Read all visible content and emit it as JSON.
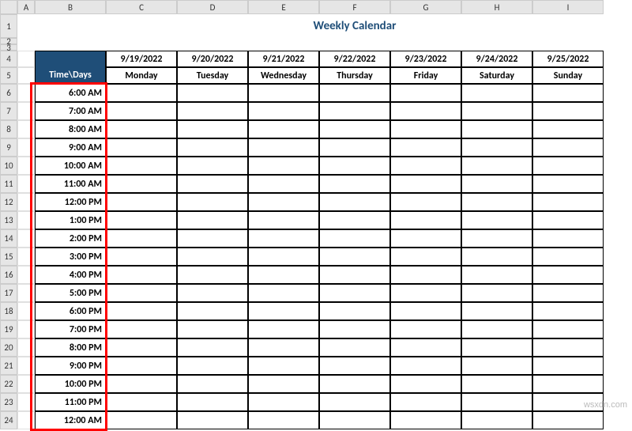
{
  "columns": [
    "",
    "A",
    "B",
    "C",
    "D",
    "E",
    "F",
    "G",
    "H",
    "I"
  ],
  "title": "Weekly Calendar",
  "corner_label": "Time\\Days",
  "dates": [
    "9/19/2022",
    "9/20/2022",
    "9/21/2022",
    "9/22/2022",
    "9/23/2022",
    "9/24/2022",
    "9/25/2022"
  ],
  "days": [
    "Monday",
    "Tuesday",
    "Wednesday",
    "Thursday",
    "Friday",
    "Saturday",
    "Sunday"
  ],
  "times": [
    "6:00 AM",
    "7:00 AM",
    "8:00 AM",
    "9:00 AM",
    "10:00 AM",
    "11:00 AM",
    "12:00 PM",
    "1:00 PM",
    "2:00 PM",
    "3:00 PM",
    "4:00 PM",
    "5:00 PM",
    "6:00 PM",
    "7:00 PM",
    "8:00 PM",
    "9:00 PM",
    "10:00 PM",
    "11:00 PM",
    "12:00 AM"
  ],
  "row_start_headers": 1,
  "visible_rows": [
    "1",
    "2",
    "3",
    "4",
    "5",
    "6",
    "7",
    "8",
    "9",
    "10",
    "11",
    "12",
    "13",
    "14",
    "15",
    "16",
    "17",
    "18",
    "19",
    "20",
    "21",
    "22",
    "23",
    "24"
  ],
  "watermark": "wsxdn.com"
}
